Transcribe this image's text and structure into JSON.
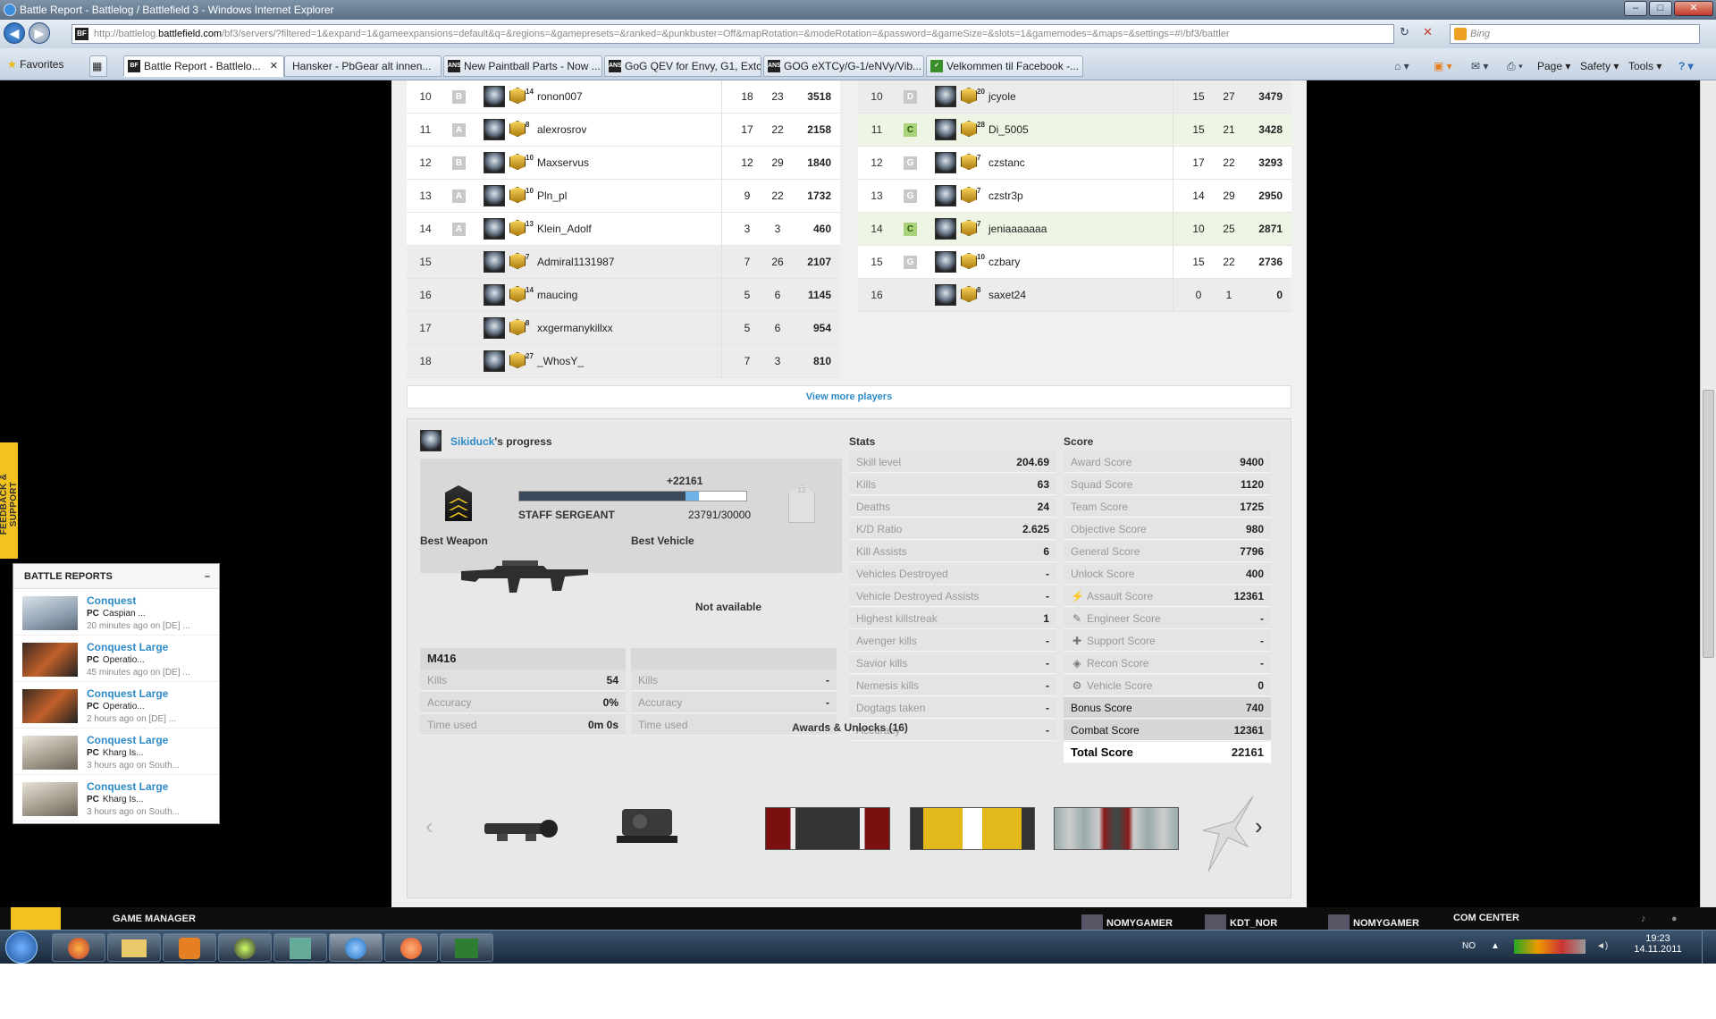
{
  "window": {
    "title": "Battle Report - Battlelog / Battlefield 3 - Windows Internet Explorer",
    "min": "–",
    "max": "□",
    "close": "✕"
  },
  "address": {
    "url_prefix": "http://battlelog.",
    "url_host": "battlefield.com",
    "url_rest": "/bf3/servers/?filtered=1&expand=1&gameexpansions=default&q=&regions=&gamepresets=&ranked=&punkbuster=Off&mapRotation=&modeRotation=&password=&gameSize=&slots=1&gamemodes=&maps=&settings=#!/bf3/battler",
    "search_placeholder": "Bing",
    "favicon": "BF"
  },
  "tabs": [
    {
      "label": "Favorites"
    },
    {
      "label": "Battle Report - Battlelo...",
      "close": "✕"
    },
    {
      "label": "Hansker - PbGear alt innen..."
    },
    {
      "label": "New Paintball Parts - Now ..."
    },
    {
      "label": "GoG QEV for Envy, G1, Extc..."
    },
    {
      "label": "GOG eXTCy/G-1/eNVy/Vib..."
    },
    {
      "label": "Velkommen til Facebook -..."
    }
  ],
  "tools": {
    "page": "Page ▾",
    "safety": "Safety ▾",
    "tools": "Tools ▾",
    "help": "? ▾"
  },
  "team_left": [
    {
      "n": "10",
      "sq": "B",
      "rank": "14",
      "name": "ronon007",
      "k": "18",
      "d": "23",
      "score": "3518",
      "gray": false
    },
    {
      "n": "11",
      "sq": "A",
      "rank": "8",
      "name": "alexrosrov",
      "k": "17",
      "d": "22",
      "score": "2158",
      "gray": false
    },
    {
      "n": "12",
      "sq": "B",
      "rank": "10",
      "name": "Maxservus",
      "k": "12",
      "d": "29",
      "score": "1840",
      "gray": false
    },
    {
      "n": "13",
      "sq": "A",
      "rank": "10",
      "name": "Pln_pl",
      "k": "9",
      "d": "22",
      "score": "1732",
      "gray": false
    },
    {
      "n": "14",
      "sq": "A",
      "rank": "13",
      "name": "Klein_Adolf",
      "k": "3",
      "d": "3",
      "score": "460",
      "gray": false
    },
    {
      "n": "15",
      "sq": "",
      "rank": "7",
      "name": "Admiral1131987",
      "k": "7",
      "d": "26",
      "score": "2107",
      "gray": true
    },
    {
      "n": "16",
      "sq": "",
      "rank": "14",
      "name": "maucing",
      "k": "5",
      "d": "6",
      "score": "1145",
      "gray": true
    },
    {
      "n": "17",
      "sq": "",
      "rank": "8",
      "name": "xxgermanykillxx",
      "k": "5",
      "d": "6",
      "score": "954",
      "gray": true
    },
    {
      "n": "18",
      "sq": "",
      "rank": "27",
      "name": "_WhosY_",
      "k": "7",
      "d": "3",
      "score": "810",
      "gray": true
    }
  ],
  "team_right": [
    {
      "n": "10",
      "sq": "D",
      "rank": "20",
      "name": "jcyole",
      "k": "15",
      "d": "27",
      "score": "3479",
      "style": "gray"
    },
    {
      "n": "11",
      "sq": "C",
      "rank": "28",
      "name": "Di_5005",
      "k": "15",
      "d": "21",
      "score": "3428",
      "style": "hl"
    },
    {
      "n": "12",
      "sq": "G",
      "rank": "7",
      "name": "czstanc",
      "k": "17",
      "d": "22",
      "score": "3293",
      "style": ""
    },
    {
      "n": "13",
      "sq": "G",
      "rank": "7",
      "name": "czstr3p",
      "k": "14",
      "d": "29",
      "score": "2950",
      "style": ""
    },
    {
      "n": "14",
      "sq": "C",
      "rank": "7",
      "name": "jeniaaaaaaa",
      "k": "10",
      "d": "25",
      "score": "2871",
      "style": "hl"
    },
    {
      "n": "15",
      "sq": "G",
      "rank": "10",
      "name": "czbary",
      "k": "15",
      "d": "22",
      "score": "2736",
      "style": ""
    },
    {
      "n": "16",
      "sq": "",
      "rank": "8",
      "name": "saxet24",
      "k": "0",
      "d": "1",
      "score": "0",
      "style": "gray"
    }
  ],
  "view_more": "View more players",
  "progress": {
    "user": "Sikiduck",
    "suffix": "'s progress",
    "gain": "+22161",
    "rank_name": "STAFF SERGEANT",
    "xp": "23791/30000",
    "progress_fraction": 0.793,
    "gain_fraction": 0.062,
    "next_rank": "12"
  },
  "best": {
    "weapon_label": "Best Weapon",
    "vehicle_label": "Best Vehicle",
    "vehicle_na": "Not available",
    "weapon_name": "M416",
    "weapon_stats": [
      {
        "l": "Kills",
        "v": "54"
      },
      {
        "l": "Accuracy",
        "v": "0%"
      },
      {
        "l": "Time used",
        "v": "0m 0s"
      }
    ],
    "vehicle_stats": [
      {
        "l": "Kills",
        "v": "-"
      },
      {
        "l": "Accuracy",
        "v": "-"
      },
      {
        "l": "Time used",
        "v": "-"
      }
    ]
  },
  "stats_title": "Stats",
  "stats": [
    {
      "l": "Skill level",
      "v": "204.69"
    },
    {
      "l": "Kills",
      "v": "63"
    },
    {
      "l": "Deaths",
      "v": "24"
    },
    {
      "l": "K/D Ratio",
      "v": "2.625"
    },
    {
      "l": "Kill Assists",
      "v": "6"
    },
    {
      "l": "Vehicles Destroyed",
      "v": "-"
    },
    {
      "l": "Vehicle Destroyed Assists",
      "v": "-"
    },
    {
      "l": "Highest killstreak",
      "v": "1"
    },
    {
      "l": "Avenger kills",
      "v": "-"
    },
    {
      "l": "Savior kills",
      "v": "-"
    },
    {
      "l": "Nemesis kills",
      "v": "-"
    },
    {
      "l": "Dogtags taken",
      "v": "-"
    },
    {
      "l": "Accuracy",
      "v": "-"
    }
  ],
  "score_title": "Score",
  "score": [
    {
      "l": "Award Score",
      "v": "9400"
    },
    {
      "l": "Squad Score",
      "v": "1120"
    },
    {
      "l": "Team Score",
      "v": "1725"
    },
    {
      "l": "Objective Score",
      "v": "980"
    },
    {
      "l": "General Score",
      "v": "7796"
    },
    {
      "l": "Unlock Score",
      "v": "400"
    },
    {
      "l": "Assault Score",
      "v": "12361",
      "icon": "⚡"
    },
    {
      "l": "Engineer Score",
      "v": "-",
      "icon": "✎"
    },
    {
      "l": "Support Score",
      "v": "-",
      "icon": "✚"
    },
    {
      "l": "Recon Score",
      "v": "-",
      "icon": "◈"
    },
    {
      "l": "Vehicle Score",
      "v": "0",
      "icon": "⚙"
    }
  ],
  "score_totals": [
    {
      "l": "Bonus Score",
      "v": "740"
    },
    {
      "l": "Combat Score",
      "v": "12361"
    },
    {
      "l": "Total Score",
      "v": "22161"
    }
  ],
  "awards_title": "Awards & Unlocks (16)",
  "awards_prev": "‹",
  "awards_next": "›",
  "feedback": "FEEDBACK & SUPPORT",
  "battle_reports": {
    "title": "BATTLE REPORTS",
    "collapse": "–",
    "items": [
      {
        "mode": "Conquest",
        "platform": "PC",
        "map": "Caspian ...",
        "time": "20 minutes ago on [DE] ..."
      },
      {
        "mode": "Conquest Large",
        "platform": "PC",
        "map": "Operatio...",
        "time": "45 minutes ago on [DE] ..."
      },
      {
        "mode": "Conquest Large",
        "platform": "PC",
        "map": "Operatio...",
        "time": "2 hours ago on [DE] ..."
      },
      {
        "mode": "Conquest Large",
        "platform": "PC",
        "map": "Kharg Is...",
        "time": "3 hours ago on South..."
      },
      {
        "mode": "Conquest Large",
        "platform": "PC",
        "map": "Kharg Is...",
        "time": "3 hours ago on South..."
      }
    ]
  },
  "game_manager": {
    "title": "GAME MANAGER",
    "friends": [
      "NOMYGAMER",
      "KDT_NOR",
      "NOMYGAMER"
    ],
    "com": "COM CENTER"
  },
  "taskbar": {
    "lang": "NO",
    "time": "19:23",
    "date": "14.11.2011"
  }
}
